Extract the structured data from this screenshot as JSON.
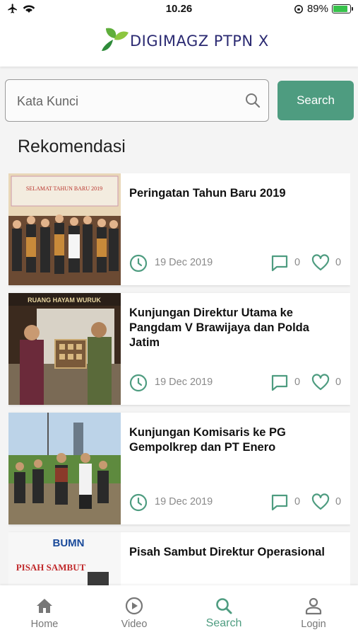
{
  "status": {
    "time": "10.26",
    "battery": "89%"
  },
  "brand": {
    "name": "DIGIMAGZ PTPN X"
  },
  "search": {
    "placeholder": "Kata Kunci",
    "button": "Search"
  },
  "section": {
    "title": "Rekomendasi"
  },
  "articles": [
    {
      "title": "Peringatan Tahun Baru 2019",
      "date": "19 Dec 2019",
      "comments": "0",
      "likes": "0",
      "thumb_banner": "SELAMAT TAHUN BARU 2019"
    },
    {
      "title": "Kunjungan Direktur Utama ke Pangdam V Brawijaya dan Polda Jatim",
      "date": "19 Dec 2019",
      "comments": "0",
      "likes": "0",
      "thumb_banner": "RUANG HAYAM WURUK"
    },
    {
      "title": "Kunjungan Komisaris ke PG Gempolkrep dan PT Enero",
      "date": "19 Dec 2019",
      "comments": "0",
      "likes": "0"
    },
    {
      "title": "Pisah Sambut Direktur Operasional",
      "thumb_banner": "PISAH SAMBUT",
      "thumb_logo": "BUMN"
    }
  ],
  "nav": [
    {
      "label": "Home",
      "icon": "home-icon"
    },
    {
      "label": "Video",
      "icon": "play-circle-icon"
    },
    {
      "label": "Search",
      "icon": "search-icon"
    },
    {
      "label": "Login",
      "icon": "user-icon"
    }
  ],
  "colors": {
    "accent": "#4e9c80",
    "brand": "#2b2a72"
  }
}
